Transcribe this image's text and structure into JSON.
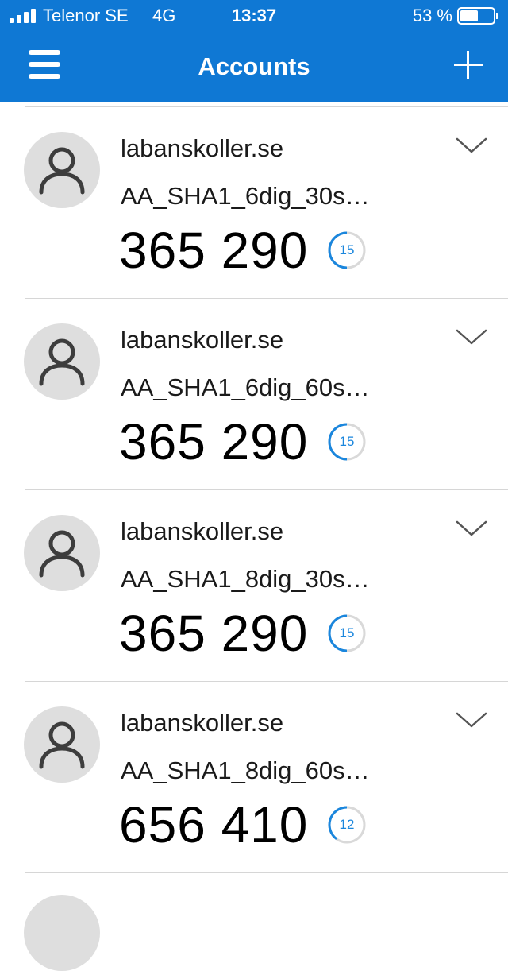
{
  "status_bar": {
    "carrier": "Telenor SE",
    "network": "4G",
    "time": "13:37",
    "battery_percent": "53 %"
  },
  "header": {
    "title": "Accounts",
    "menu_icon": "hamburger-menu-icon",
    "add_icon": "plus-icon"
  },
  "colors": {
    "accent": "#0f78d4",
    "timer_ring": "#1a86dd",
    "timer_track": "#d9d9d9",
    "avatar_bg": "#dedede"
  },
  "accounts": [
    {
      "name": "labanskoller.se",
      "account_id": "AA_SHA1_6dig_30s…",
      "code": "365 290",
      "timer": "15"
    },
    {
      "name": "labanskoller.se",
      "account_id": "AA_SHA1_6dig_60s…",
      "code": "365 290",
      "timer": "15"
    },
    {
      "name": "labanskoller.se",
      "account_id": "AA_SHA1_8dig_30s…",
      "code": "365 290",
      "timer": "15"
    },
    {
      "name": "labanskoller.se",
      "account_id": "AA_SHA1_8dig_60s…",
      "code": "656 410",
      "timer": "12"
    }
  ]
}
